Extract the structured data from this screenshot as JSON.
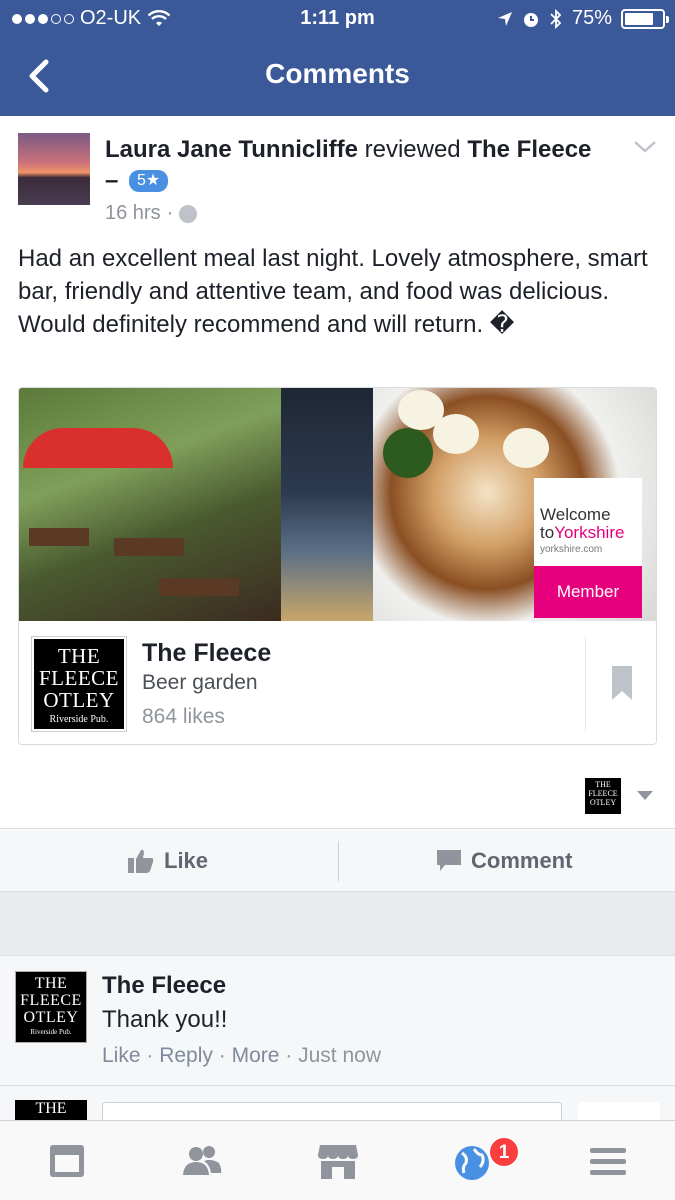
{
  "status_bar": {
    "carrier": "O2-UK",
    "time": "1:11 pm",
    "battery": "75%"
  },
  "nav": {
    "title": "Comments"
  },
  "post": {
    "author": "Laura Jane Tunnicliffe",
    "action": " reviewed ",
    "page": "The Fleece",
    "dash": " –",
    "rating": "5★",
    "time": "16 hrs",
    "body": "Had an excellent meal last night. Lovely atmosphere, smart bar, friendly and attentive team, and food was delicious. Would definitely recommend and will return. �"
  },
  "link_card": {
    "photo": {
      "welcome_line1": "Welcome",
      "welcome_to": "to",
      "welcome_yorkshire": "Yorkshire",
      "welcome_url": "yorkshire.com",
      "member_label": "Member"
    },
    "logo": {
      "line1": "THE",
      "line2": "FLEECE",
      "line3": "OTLEY",
      "tagline": "Riverside Pub."
    },
    "name": "The Fleece",
    "category": "Beer garden",
    "likes": "864 likes"
  },
  "actions": {
    "like": "Like",
    "comment": "Comment"
  },
  "comment": {
    "author": "The Fleece",
    "text": "Thank you!!",
    "like": "Like",
    "reply": "Reply",
    "more": "More",
    "time": "Just now",
    "sep": " · "
  },
  "compose_logo": "THE",
  "tabs": {
    "notifications_badge": "1"
  },
  "colors": {
    "brand": "#3b5998",
    "badge": "#fa3e3e",
    "rating_badge": "#4a90e2",
    "yorkshire_pink": "#e6007e"
  },
  "icons": [
    "back-chevron-icon",
    "wifi-icon",
    "location-arrow-icon",
    "alarm-icon",
    "bluetooth-icon",
    "battery-icon",
    "globe-icon",
    "chevron-down-icon",
    "bookmark-icon",
    "thumbs-up-icon",
    "comment-icon",
    "news-feed-icon",
    "friends-icon",
    "marketplace-icon",
    "notifications-globe-icon",
    "menu-icon"
  ]
}
